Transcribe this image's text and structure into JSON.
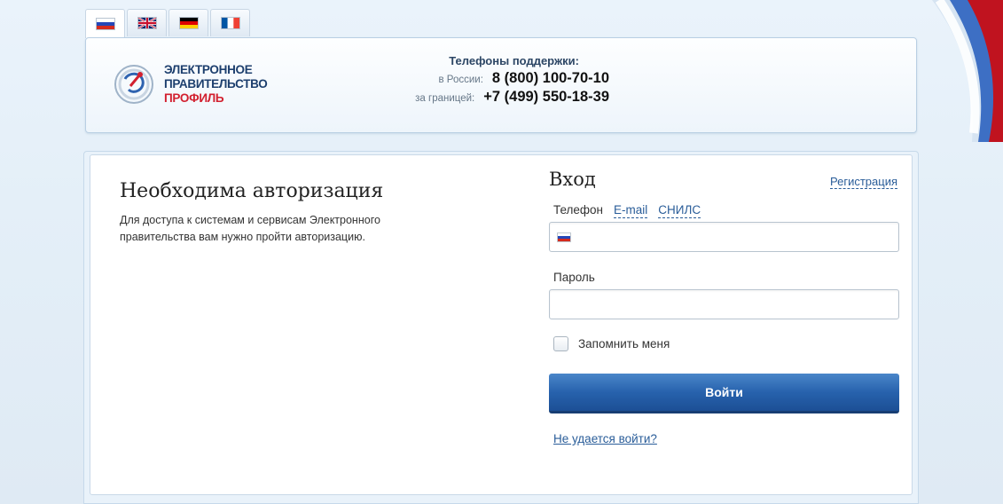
{
  "languages": [
    {
      "name": "russian-flag",
      "active": true
    },
    {
      "name": "english-flag",
      "active": false
    },
    {
      "name": "german-flag",
      "active": false
    },
    {
      "name": "french-flag",
      "active": false
    }
  ],
  "header": {
    "logo": {
      "line1": "ЭЛЕКТРОННОЕ",
      "line2": "ПРАВИТЕЛЬСТВО",
      "line3": "ПРОФИЛЬ"
    },
    "support": {
      "title": "Телефоны поддержки:",
      "russia_label": "в России:",
      "russia_phone": "8 (800) 100-70-10",
      "abroad_label": "за границей:",
      "abroad_phone": "+7 (499) 550-18-39"
    }
  },
  "auth": {
    "title": "Необходима авторизация",
    "description": "Для доступа к системам и сервисам Электронного правительства вам нужно пройти авторизацию."
  },
  "login": {
    "title": "Вход",
    "register_link": "Регистрация",
    "tabs": [
      {
        "label": "Телефон",
        "active": true
      },
      {
        "label": "E-mail",
        "active": false
      },
      {
        "label": "СНИЛС",
        "active": false
      }
    ],
    "phone_value": "",
    "password_label": "Пароль",
    "password_value": "",
    "remember_label": "Запомнить меня",
    "remember_checked": false,
    "submit_label": "Войти",
    "forgot_link": "Не удается войти?"
  },
  "colors": {
    "accent": "#2762ad",
    "link": "#2a5d99",
    "logo_blue": "#1d3f6e",
    "logo_red": "#d2202f"
  }
}
